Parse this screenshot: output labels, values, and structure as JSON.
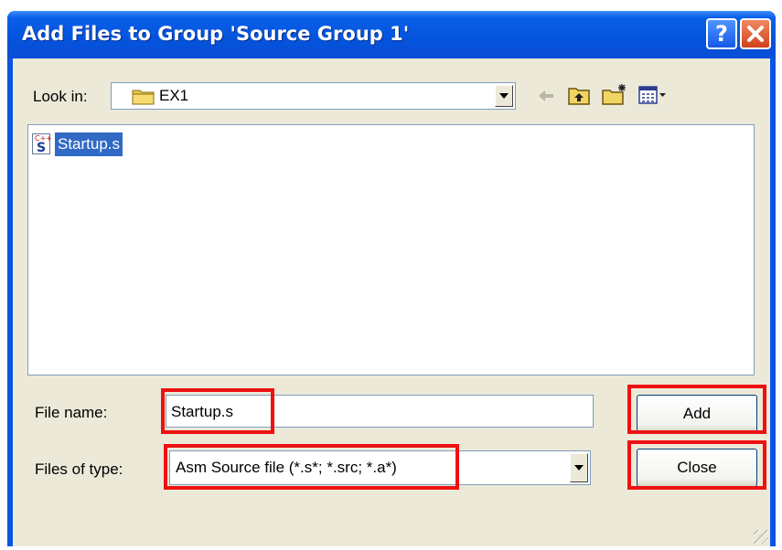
{
  "window": {
    "title": "Add Files to Group 'Source Group 1'",
    "help_label": "?"
  },
  "look_in": {
    "label": "Look in:",
    "value": "EX1"
  },
  "toolbar": {
    "icons": [
      "back-arrow-icon",
      "up-folder-icon",
      "new-folder-icon",
      "view-menu-icon"
    ]
  },
  "file_list": {
    "items": [
      {
        "name": "Startup.s",
        "icon": "asm-source-file-icon",
        "icon_badge": "C++",
        "icon_letter": "S",
        "selected": true
      }
    ]
  },
  "file_name": {
    "label": "File name:",
    "value": "Startup.s"
  },
  "files_of_type": {
    "label": "Files of type:",
    "value": "Asm Source file (*.s*; *.src; *.a*)"
  },
  "buttons": {
    "add": "Add",
    "close": "Close"
  },
  "colors": {
    "title_bar": "#0453dc",
    "dialog_face": "#ece9d8",
    "selection": "#316ac5",
    "highlight_box": "#ee1111"
  }
}
